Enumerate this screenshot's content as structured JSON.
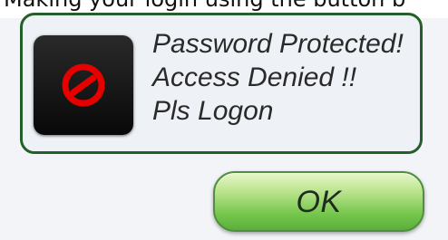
{
  "top_text": "Making your login using the button b",
  "dialog": {
    "icon": "prohibited-icon",
    "message_lines": [
      "Password Protected!",
      "Access Denied !!",
      "Pls Logon"
    ],
    "ok_label": "OK"
  },
  "colors": {
    "panel_border": "#245f2a",
    "icon_tile": "#111111",
    "prohibited_icon": "#e60000",
    "button_fill": "#78c84f",
    "button_border": "#4f8f3f"
  }
}
